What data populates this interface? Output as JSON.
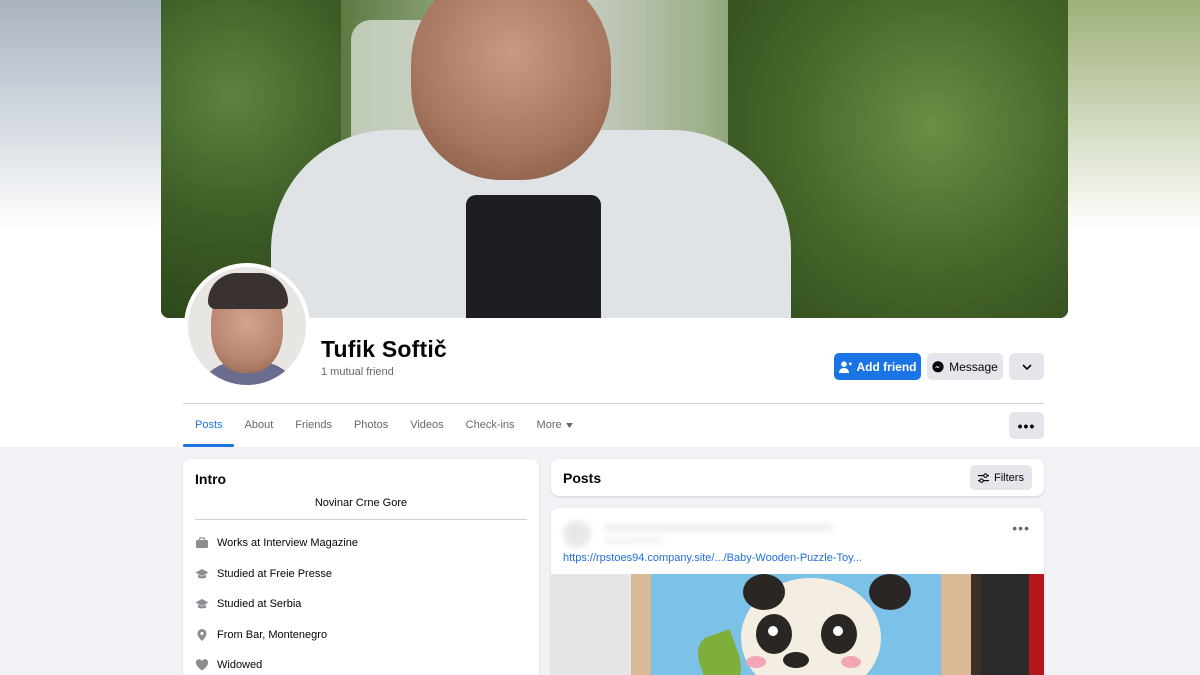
{
  "profile": {
    "name": "Tufik Softič",
    "mutual": "1 mutual friend"
  },
  "actions": {
    "add_friend": "Add friend",
    "message": "Message"
  },
  "tabs": [
    {
      "label": "Posts",
      "active": true
    },
    {
      "label": "About"
    },
    {
      "label": "Friends"
    },
    {
      "label": "Photos"
    },
    {
      "label": "Videos"
    },
    {
      "label": "Check-ins"
    },
    {
      "label": "More"
    }
  ],
  "intro": {
    "title": "Intro",
    "bio": "Novinar Crne Gore",
    "items": [
      {
        "icon": "briefcase-icon",
        "prefix": "Works at ",
        "value": "Interview Magazine"
      },
      {
        "icon": "graduation-cap-icon",
        "prefix": "Studied at ",
        "value": "Freie Presse"
      },
      {
        "icon": "graduation-cap-icon",
        "prefix": "Studied at ",
        "value": "Serbia"
      },
      {
        "icon": "location-pin-icon",
        "prefix": "From ",
        "value": "Bar, Montenegro"
      },
      {
        "icon": "heart-icon",
        "prefix": "",
        "value": "Widowed"
      }
    ]
  },
  "posts": {
    "title": "Posts",
    "filters": "Filters",
    "link": "https://rpstoes94.company.site/.../Baby-Wooden-Puzzle-Toy..."
  },
  "colors": {
    "accent": "#1b74e4",
    "link": "#216fdb",
    "muted": "#65676b"
  }
}
